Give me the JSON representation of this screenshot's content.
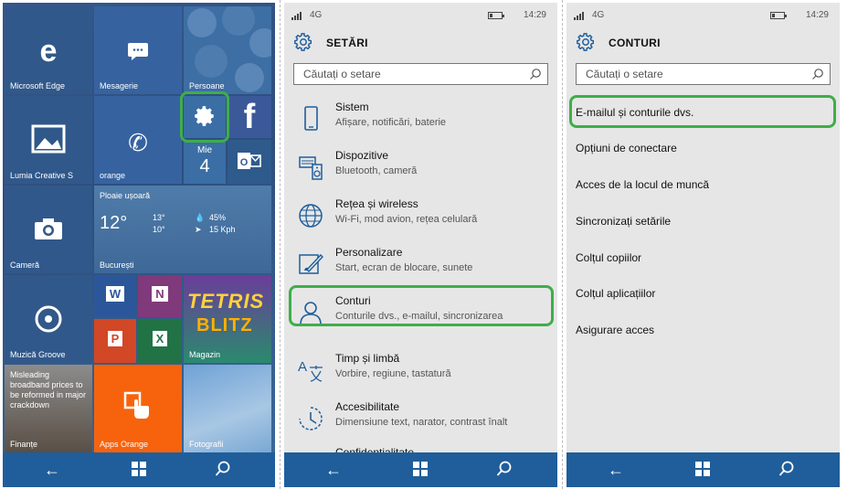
{
  "status": {
    "network": "4G",
    "time": "14:29"
  },
  "start": {
    "tiles": {
      "edge": "Microsoft Edge",
      "messaging": "Mesagerie",
      "people": "Persoane",
      "photos": "Lumia Creative S",
      "phone": "orange",
      "calendar_day": "Mie",
      "calendar_date": "4",
      "weather_title": "Ploaie ușoară",
      "weather_temp": "12°",
      "weather_high": "13°",
      "weather_low": "10°",
      "weather_precip": "45%",
      "weather_wind": "15 Kph",
      "weather_city": "București",
      "camera": "Cameră",
      "word": "W",
      "onenote": "N",
      "powerpoint": "P",
      "excel": "X",
      "store": "Magazin",
      "store_game1": "TETRIS",
      "store_game2": "BLITZ",
      "music": "Muzică Groove",
      "news_headline": "Misleading broadband prices to be reformed in major crackdown",
      "finance": "Finanțe",
      "apps_orange": "Apps Orange",
      "photos2": "Fotografii",
      "facebook": "f"
    }
  },
  "settings": {
    "title": "SETĂRI",
    "search_placeholder": "Căutați o setare",
    "items": [
      {
        "title": "Sistem",
        "sub": "Afișare, notificări, baterie",
        "icon": "phone-icon"
      },
      {
        "title": "Dispozitive",
        "sub": "Bluetooth, cameră",
        "icon": "devices-icon"
      },
      {
        "title": "Rețea și wireless",
        "sub": "Wi-Fi, mod avion, rețea celulară",
        "icon": "globe-icon"
      },
      {
        "title": "Personalizare",
        "sub": "Start, ecran de blocare, sunete",
        "icon": "paint-icon"
      },
      {
        "title": "Conturi",
        "sub": "Conturile dvs., e-mailul, sincronizarea",
        "icon": "person-icon"
      },
      {
        "title": "Timp și limbă",
        "sub": "Vorbire, regiune, tastatură",
        "icon": "language-icon"
      },
      {
        "title": "Accesibilitate",
        "sub": "Dimensiune text, narator, contrast înalt",
        "icon": "accessibility-icon"
      },
      {
        "title": "Confidențialitate",
        "sub": "",
        "icon": "privacy-icon"
      }
    ]
  },
  "accounts": {
    "title": "CONTURI",
    "search_placeholder": "Căutați o setare",
    "items": [
      "E-mailul și conturile dvs.",
      "Opțiuni de conectare",
      "Acces de la locul de muncă",
      "Sincronizați setările",
      "Colțul copiilor",
      "Colțul aplicațiilor",
      "Asigurare acces"
    ]
  },
  "colors": {
    "highlight": "#3fae49",
    "nav": "#1f5e9b",
    "tile": "#3a6ea5",
    "orange": "#f7630c"
  }
}
